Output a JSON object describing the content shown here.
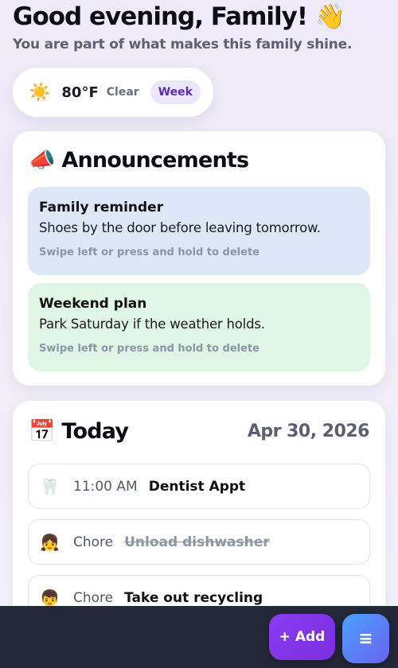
{
  "header": {
    "greeting": "Good evening, Family! 👋",
    "subtitle": "You are part of what makes this family shine."
  },
  "weather": {
    "icon": "☀️",
    "temp": "80°F",
    "condition": "Clear",
    "range_label": "Week"
  },
  "announcements": {
    "title": "📣 Announcements",
    "items": [
      {
        "title": "Family reminder",
        "body": "Shoes by the door before leaving tomorrow.",
        "hint": "Swipe left or press and hold to delete"
      },
      {
        "title": "Weekend plan",
        "body": "Park Saturday if the weather holds.",
        "hint": "Swipe left or press and hold to delete"
      }
    ]
  },
  "today": {
    "title": "📅 Today",
    "date": "Apr 30, 2026",
    "events": [
      {
        "icon": "🦷",
        "time": "11:00 AM",
        "title": "Dentist Appt",
        "done": false
      },
      {
        "icon": "👧",
        "time": "Chore",
        "title": "Unload dishwasher",
        "done": true
      },
      {
        "icon": "👦",
        "time": "Chore",
        "title": "Take out recycling",
        "done": false
      }
    ]
  },
  "actions": {
    "add_label": "+ Add",
    "menu_label": "≡"
  }
}
